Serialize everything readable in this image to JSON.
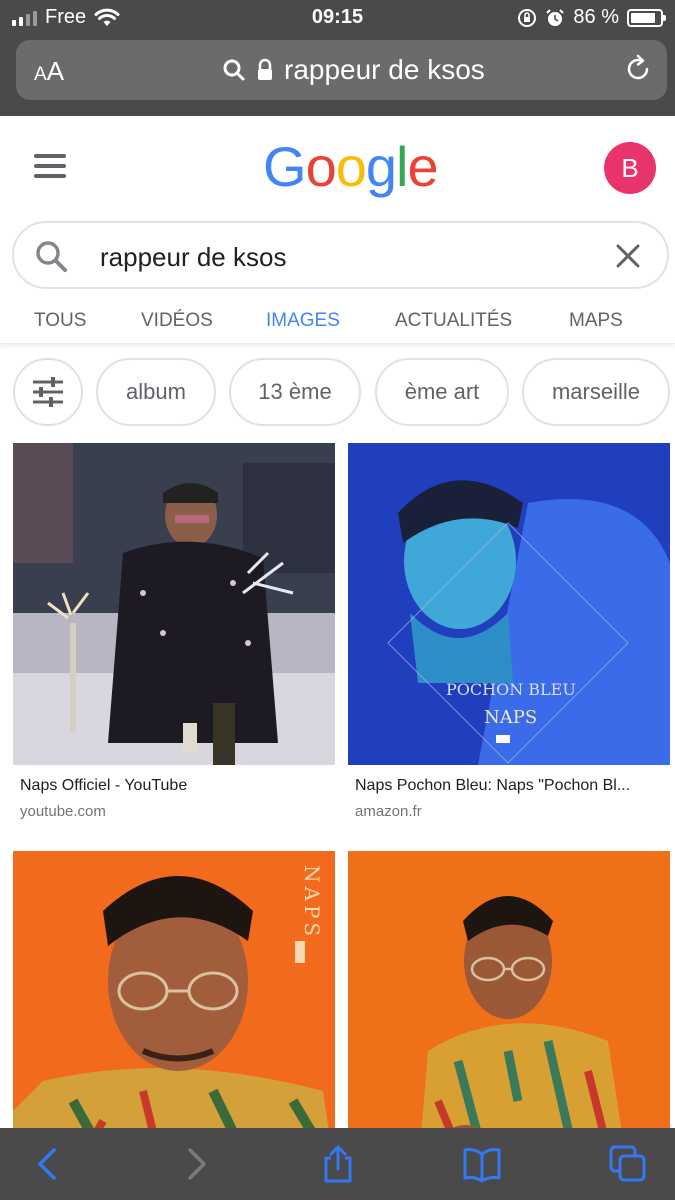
{
  "status": {
    "carrier": "Free",
    "time": "09:15",
    "battery": "86 %",
    "battery_level": 0.86
  },
  "safari": {
    "text_size_label_small": "A",
    "text_size_label_large": "A",
    "url": "rappeur de ksos"
  },
  "google": {
    "logo": [
      "G",
      "o",
      "o",
      "g",
      "l",
      "e"
    ],
    "logo_colors": [
      "#4285f4",
      "#ea4335",
      "#fbbc05",
      "#4285f4",
      "#34a853",
      "#ea4335"
    ],
    "avatar_letter": "B",
    "query": "rappeur de ksos"
  },
  "tabs": [
    {
      "label": "TOUS",
      "active": false
    },
    {
      "label": "VIDÉOS",
      "active": false
    },
    {
      "label": "IMAGES",
      "active": true
    },
    {
      "label": "ACTUALITÉS",
      "active": false
    },
    {
      "label": "MAPS",
      "active": false
    }
  ],
  "chips": [
    "album",
    "13 ème",
    "ème art",
    "marseille"
  ],
  "results": [
    {
      "title": "Naps Officiel - YouTube",
      "source": "youtube.com"
    },
    {
      "title": "Naps Pochon Bleu: Naps \"Pochon Bl...",
      "source": "amazon.fr",
      "cover_text_1": "POCHON BLEU",
      "cover_text_2": "NAPS"
    },
    {
      "title": "",
      "source": "",
      "cover_text": "NAPS"
    },
    {
      "title": "",
      "source": ""
    }
  ],
  "colors": {
    "chrome": "#4a4a4a",
    "accent": "#4285f4",
    "avatar": "#e8336b",
    "ios_blue": "#3478f6"
  }
}
